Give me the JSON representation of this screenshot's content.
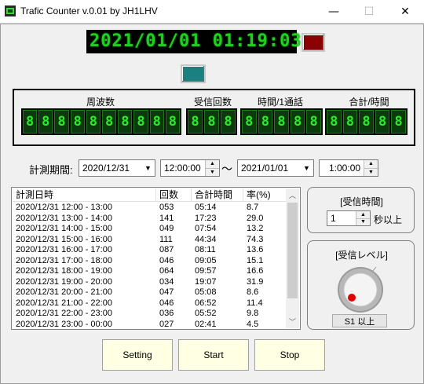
{
  "window": {
    "title": "Trafic Counter v.0.01 by JH1LHV",
    "minimize_glyph": "—",
    "maximize_glyph": "☐",
    "close_glyph": "✕"
  },
  "clock": {
    "text": "2021/01/01 01:19:03"
  },
  "colors": {
    "led_green": "#1fd01f",
    "indicator_red": "#8b0000",
    "indicator_teal": "#1a8080",
    "button_bg": "#ffffe3"
  },
  "display": {
    "freq_label": "周波数",
    "count_label": "受信回数",
    "per_call_label": "時間/1通話",
    "total_label": "合計/時間",
    "freq_digits": [
      "8",
      "8",
      "8",
      "8",
      "8",
      "8",
      "8",
      "8",
      "8",
      "8"
    ],
    "count_digits": [
      "8",
      "8",
      "8"
    ],
    "per_call_digits": [
      "8",
      "8",
      "8",
      "8",
      "8"
    ],
    "total_digits": [
      "8",
      "8",
      "8",
      "8",
      "8"
    ]
  },
  "period": {
    "label": "計測期間:",
    "start_date": "2020/12/31",
    "start_time": "12:00:00",
    "tilde": "～",
    "end_date": "2021/01/01",
    "end_time": "1:00:00"
  },
  "list": {
    "headers": [
      "計測日時",
      "回数",
      "合計時間",
      "率(%)"
    ],
    "rows": [
      [
        "2020/12/31 12:00 - 13:00",
        "053",
        "05:14",
        "8.7"
      ],
      [
        "2020/12/31 13:00 - 14:00",
        "141",
        "17:23",
        "29.0"
      ],
      [
        "2020/12/31 14:00 - 15:00",
        "049",
        "07:54",
        "13.2"
      ],
      [
        "2020/12/31 15:00 - 16:00",
        "111",
        "44:34",
        "74.3"
      ],
      [
        "2020/12/31 16:00 - 17:00",
        "087",
        "08:11",
        "13.6"
      ],
      [
        "2020/12/31 17:00 - 18:00",
        "046",
        "09:05",
        "15.1"
      ],
      [
        "2020/12/31 18:00 - 19:00",
        "064",
        "09:57",
        "16.6"
      ],
      [
        "2020/12/31 19:00 - 20:00",
        "034",
        "19:07",
        "31.9"
      ],
      [
        "2020/12/31 20:00 - 21:00",
        "047",
        "05:08",
        "8.6"
      ],
      [
        "2020/12/31 21:00 - 22:00",
        "046",
        "06:52",
        "11.4"
      ],
      [
        "2020/12/31 22:00 - 23:00",
        "036",
        "05:52",
        "9.8"
      ],
      [
        "2020/12/31 23:00 - 00:00",
        "027",
        "02:41",
        "4.5"
      ]
    ]
  },
  "receive_time": {
    "label": "[受信時間]",
    "value": "1",
    "unit": "秒以上"
  },
  "receive_level": {
    "label": "[受信レベル]",
    "button_label": "S1 以上"
  },
  "buttons": {
    "setting": "Setting",
    "start": "Start",
    "stop": "Stop"
  }
}
